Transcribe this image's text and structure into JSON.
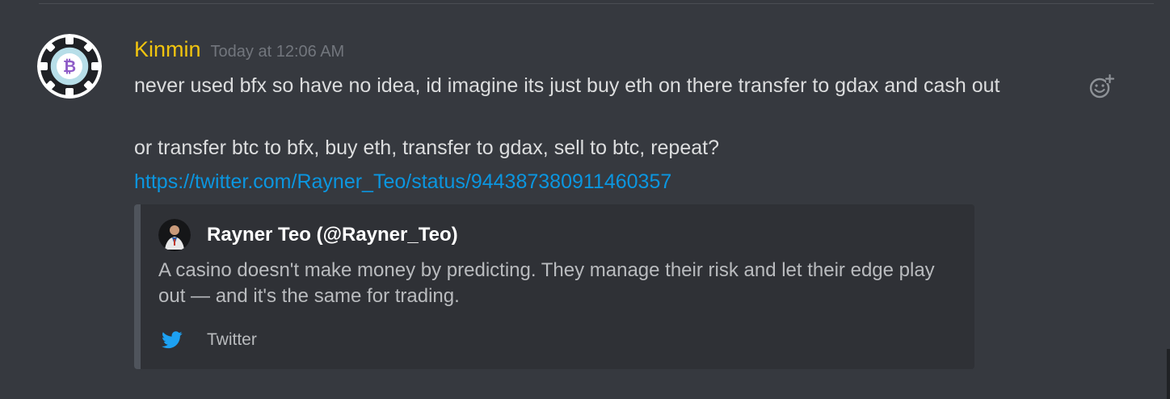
{
  "message": {
    "author": {
      "username": "Kinmin",
      "avatar_icon": "bitcoin-poker-chip-icon",
      "avatar_text": "BITCOIN",
      "color": "#f1c40f"
    },
    "timestamp": "Today at 12:06 AM",
    "lines": [
      "never used bfx so have no idea, id imagine its just buy eth on there transfer to gdax and cash out",
      "or transfer btc to bfx, buy eth, transfer to gdax, sell to btc, repeat?"
    ],
    "link": "https://twitter.com/Rayner_Teo/status/944387380911460357",
    "reaction_icon": "add-reaction-icon"
  },
  "embed": {
    "author_name": "Rayner Teo (@Rayner_Teo)",
    "author_avatar_icon": "person-avatar-icon",
    "description": "A casino doesn't make money by predicting. They manage their risk and let their edge play out — and it's the same for trading.",
    "footer_icon": "twitter-bird-icon",
    "footer_text": "Twitter",
    "twitter_color": "#1da1f2"
  },
  "colors": {
    "background": "#36393f",
    "embed_background": "#2f3136",
    "link": "#0b96e0",
    "text": "#dcddde",
    "muted": "#72767d"
  }
}
